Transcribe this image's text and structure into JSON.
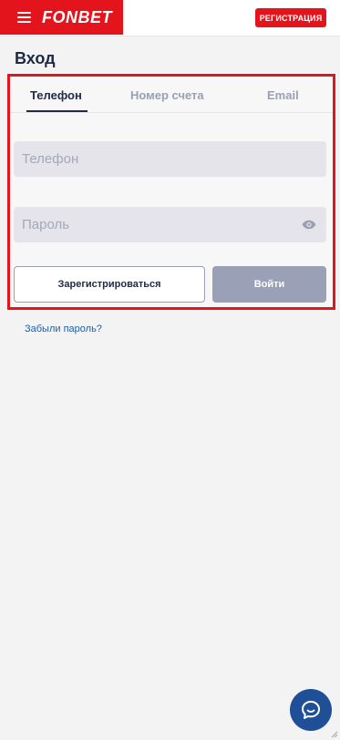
{
  "header": {
    "brand": "FONBET",
    "register_label": "РЕГИСТРАЦИЯ",
    "brand_color": "#e3141c"
  },
  "page": {
    "title": "Вход"
  },
  "tabs": [
    {
      "label": "Телефон",
      "active": true
    },
    {
      "label": "Номер счета",
      "active": false
    },
    {
      "label": "Email",
      "active": false
    }
  ],
  "form": {
    "phone_placeholder": "Телефон",
    "phone_value": "",
    "password_placeholder": "Пароль",
    "password_value": "",
    "register_label": "Зарегистрироваться",
    "login_label": "Войти",
    "forgot_label": "Забыли пароль?"
  },
  "icons": {
    "menu": "hamburger-menu-icon",
    "eye": "eye-icon",
    "chat": "chat-icon"
  },
  "colors": {
    "text_dark": "#1f2a44",
    "muted": "#9aa0b1",
    "link": "#1b5fa8",
    "chat": "#1f4f96",
    "highlight": "#e3141c"
  }
}
